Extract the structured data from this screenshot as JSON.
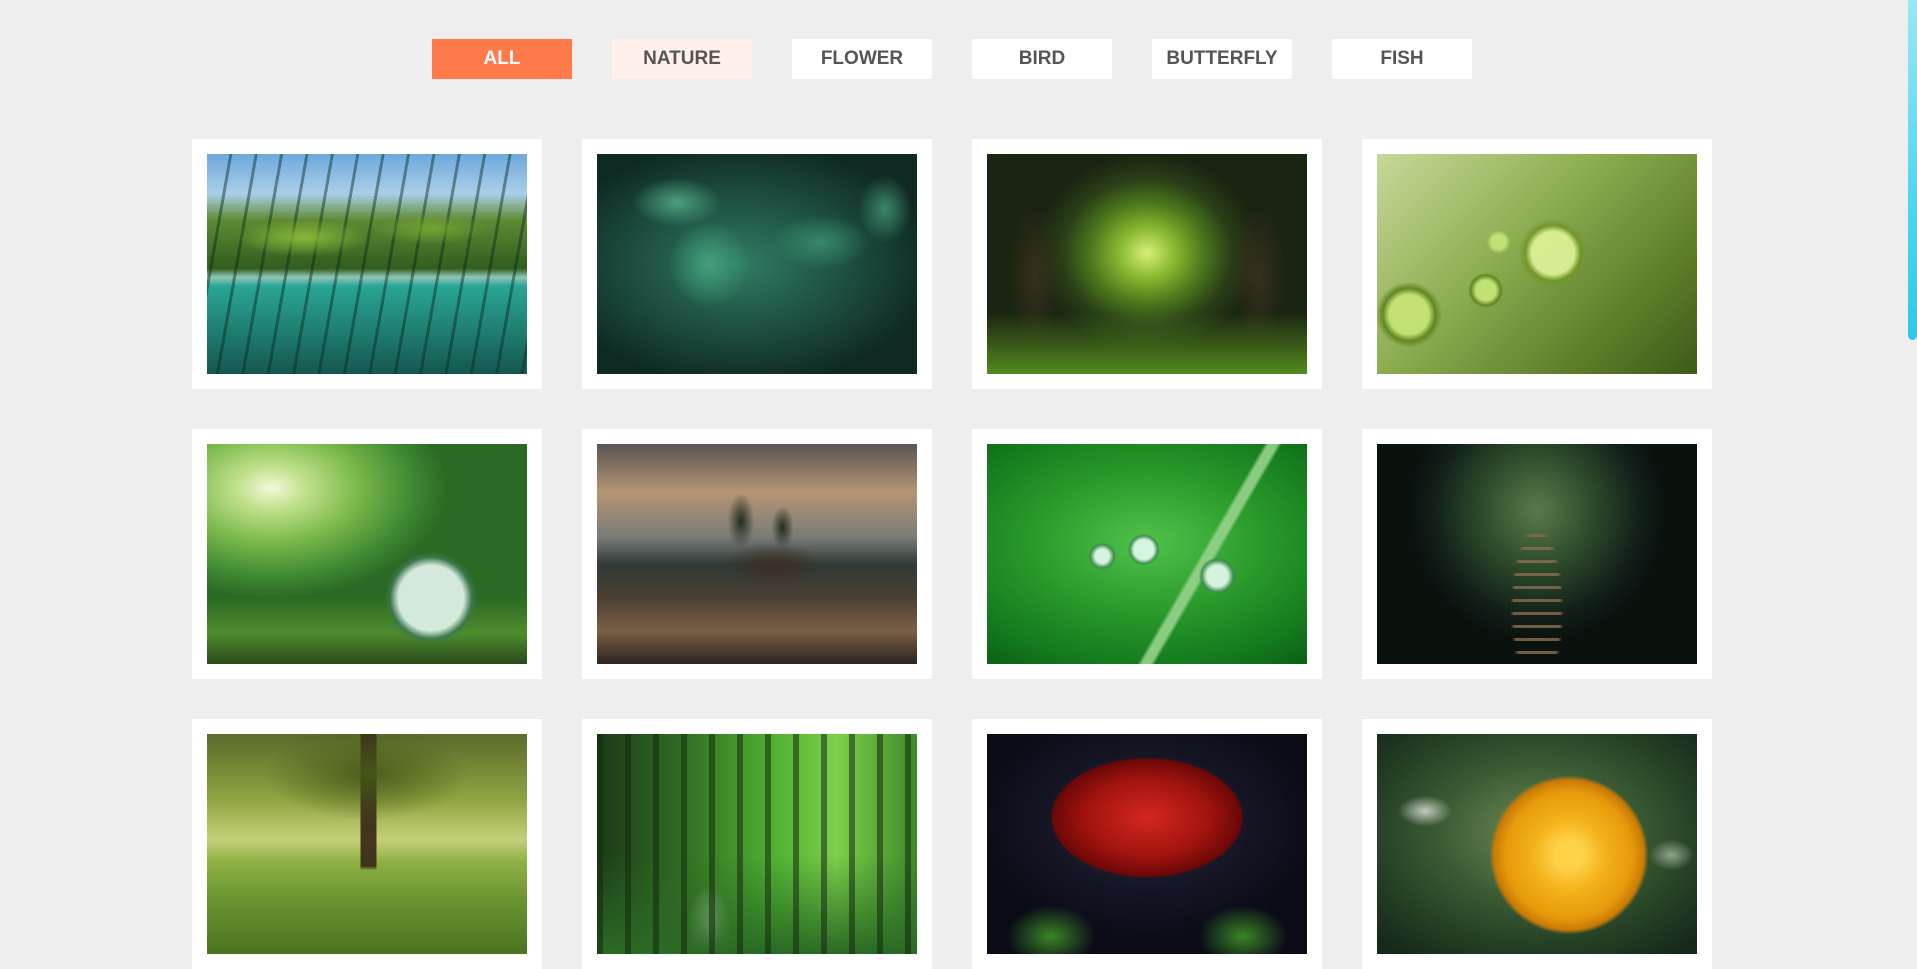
{
  "filters": [
    {
      "label": "ALL",
      "state": "active"
    },
    {
      "label": "NATURE",
      "state": "hover"
    },
    {
      "label": "FLOWER",
      "state": "default"
    },
    {
      "label": "BIRD",
      "state": "default"
    },
    {
      "label": "BUTTERFLY",
      "state": "default"
    },
    {
      "label": "FISH",
      "state": "default"
    }
  ],
  "colors": {
    "page_background": "#eeeeee",
    "active_filter": "#ff7a4a",
    "hover_filter": "#fff0ec",
    "filter_text": "#555555",
    "card_background": "#ffffff",
    "scrollbar": "#2ec8ea"
  },
  "gallery": [
    {
      "subject": "mangrove-underwater-photo"
    },
    {
      "subject": "dewy-leaves-photo"
    },
    {
      "subject": "forest-tunnel-photo"
    },
    {
      "subject": "leaf-water-drops-photo"
    },
    {
      "subject": "glass-globe-moss-photo"
    },
    {
      "subject": "lake-island-storm-photo"
    },
    {
      "subject": "grass-dew-drops-photo"
    },
    {
      "subject": "jungle-steps-photo"
    },
    {
      "subject": "meadow-tree-photo"
    },
    {
      "subject": "forest-stream-photo"
    },
    {
      "subject": "red-rose-photo"
    },
    {
      "subject": "yellow-rose-photo"
    }
  ]
}
